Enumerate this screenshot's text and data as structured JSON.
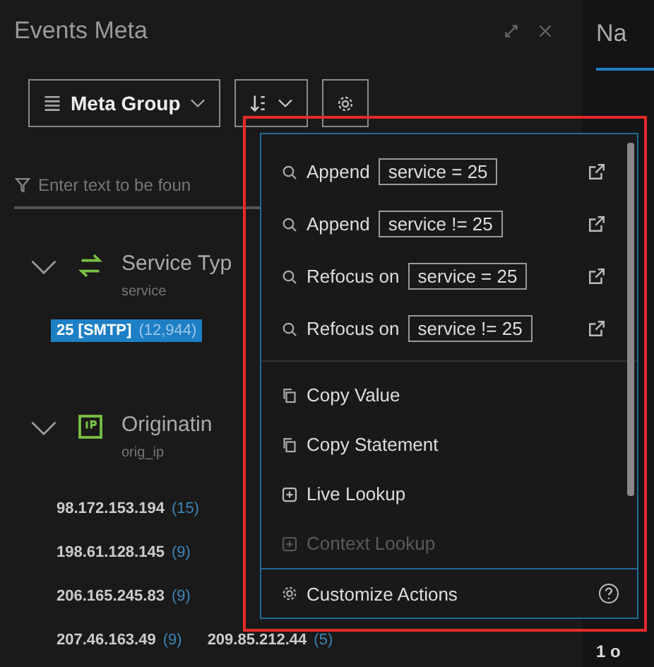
{
  "panel": {
    "title": "Events Meta"
  },
  "toolbar": {
    "group_select": "Meta Group"
  },
  "filter": {
    "placeholder": "Enter text to be foun"
  },
  "groups": [
    {
      "title": "Service Typ",
      "key": "service",
      "rows": [
        [
          {
            "value": "25 [SMTP]",
            "count": "(12,944)",
            "selected": true
          }
        ]
      ]
    },
    {
      "title": "Originatin",
      "key": "orig_ip",
      "rows": [
        [
          {
            "value": "98.172.153.194",
            "count": "(15)",
            "selected": false
          }
        ],
        [
          {
            "value": "198.61.128.145",
            "count": "(9)",
            "selected": false
          }
        ],
        [
          {
            "value": "206.165.245.83",
            "count": "(9)",
            "selected": false
          }
        ],
        [
          {
            "value": "207.46.163.49",
            "count": "(9)",
            "selected": false
          },
          {
            "value": "209.85.212.44",
            "count": "(5)",
            "selected": false
          }
        ]
      ]
    }
  ],
  "side_panel": {
    "title": "Na",
    "footer": "1 o"
  },
  "menu": {
    "items": [
      {
        "kind": "query",
        "label": "Append",
        "expression": "service = 25",
        "disabled": false
      },
      {
        "kind": "query",
        "label": "Append",
        "expression": "service != 25",
        "disabled": false
      },
      {
        "kind": "query",
        "label": "Refocus on",
        "expression": "service = 25",
        "disabled": false
      },
      {
        "kind": "query",
        "label": "Refocus on",
        "expression": "service != 25",
        "disabled": false
      },
      {
        "kind": "copy",
        "label": "Copy Value",
        "disabled": false
      },
      {
        "kind": "copy",
        "label": "Copy Statement",
        "disabled": false
      },
      {
        "kind": "lookup",
        "label": "Live Lookup",
        "disabled": false
      },
      {
        "kind": "lookup",
        "label": "Context Lookup",
        "disabled": true
      }
    ],
    "footer": "Customize Actions"
  }
}
